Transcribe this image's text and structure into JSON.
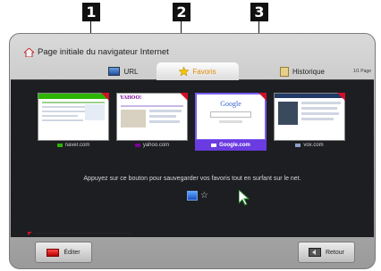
{
  "callouts": [
    "1",
    "2",
    "3"
  ],
  "window": {
    "title": "Page initiale du navigateur Internet"
  },
  "tabs": [
    {
      "label": "URL",
      "icon": "url-icon"
    },
    {
      "label": "Favoris",
      "icon": "star-icon"
    },
    {
      "label": "Historique",
      "icon": "history-icon"
    }
  ],
  "page_indicator": "1/1 Page",
  "favorites": [
    {
      "caption": "naver.com",
      "icon": "naver-favicon"
    },
    {
      "caption": "yahoo.com",
      "icon": "yahoo-favicon"
    },
    {
      "caption": "Google.com",
      "icon": "google-favicon"
    },
    {
      "caption": "vox.com",
      "icon": "vox-favicon"
    }
  ],
  "thumbnail_text": {
    "yahoo": "YAHOO!",
    "google": "Google"
  },
  "help_text": "Appuyez sur ce bouton pour sauvegarder vos favoris tout en surfant sur le net.",
  "note": "Affichage dans la fiche de navigateur Internet de la PAGE INITIALE",
  "buttons": {
    "edit": "Éditer",
    "back": "Retour"
  },
  "colors": {
    "accent": "#6a3be0",
    "panel": "#1d1e22",
    "tab_active_text": "#e08a00",
    "marker": "#d0102a"
  }
}
